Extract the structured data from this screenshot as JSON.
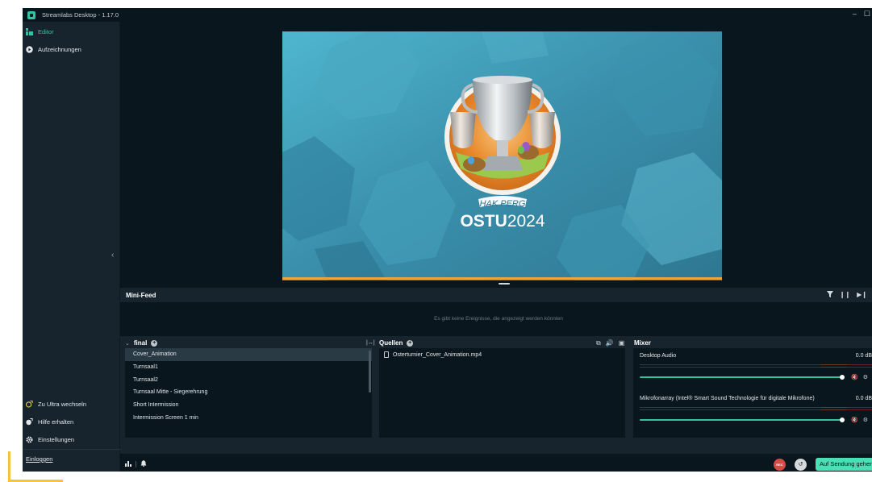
{
  "app": {
    "title": "Streamlabs Desktop - 1.17.0",
    "window_controls": [
      "–",
      "☐"
    ]
  },
  "nav": {
    "editor": "Editor",
    "recordings": "Aufzeichnungen",
    "ultra": "Zu Ultra wechseln",
    "help": "Hilfe erhalten",
    "settings": "Einstellungen",
    "login": "Einloggen"
  },
  "preview": {
    "logo_banner": "HAK PERG",
    "logo_title_bold": "OSTU",
    "logo_title_year": "2024"
  },
  "minifeed": {
    "title": "Mini-Feed",
    "empty_text": "Es gibt keine Ereignisse, die angezeigt werden könnten"
  },
  "scenes": {
    "title": "final",
    "items": [
      "Cover_Animation",
      "Turnsaal1",
      "Turnsaal2",
      "Turnsaal Mitte - Siegerehrung",
      "Short Intermission",
      "Intermission Screen 1 min"
    ],
    "active_index": 0
  },
  "sources": {
    "title": "Quellen",
    "items": [
      "Osterturnier_Cover_Animation.mp4"
    ]
  },
  "mixer": {
    "title": "Mixer",
    "channels": [
      {
        "name": "Desktop Audio",
        "value": "0.0 dB",
        "level": 1.0
      },
      {
        "name": "Mikrofonarray (Intel® Smart Sound Technologie für digitale Mikrofone)",
        "value": "0.0 dB",
        "level": 1.0
      }
    ]
  },
  "footer": {
    "rec_label": "REC",
    "go_live": "Auf Sendung gehen"
  },
  "colors": {
    "accent": "#31c3a2",
    "go_live": "#49e0b3",
    "rec": "#d24b45",
    "canvas_bg": "#3d93ad",
    "progress_bar": "#f0a33a"
  }
}
